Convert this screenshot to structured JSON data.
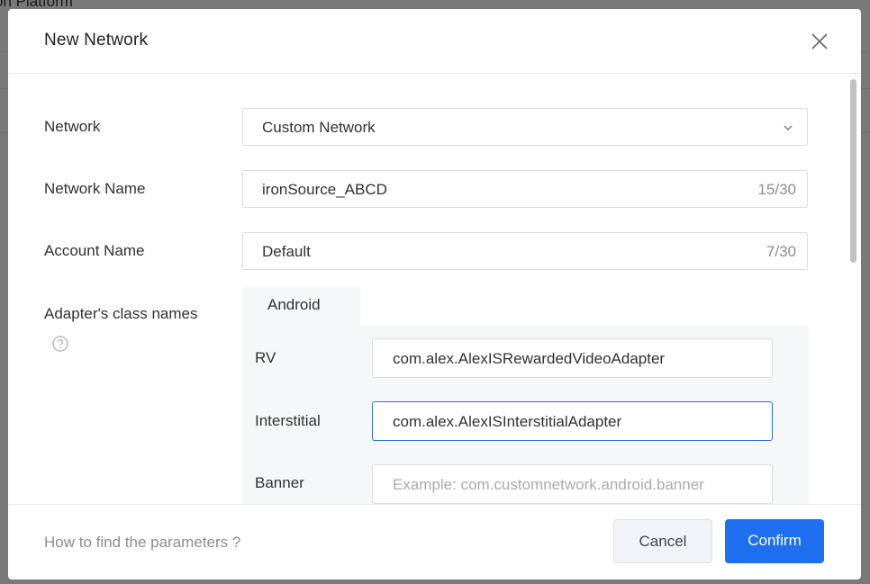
{
  "background": {
    "app_title": "on Platform"
  },
  "modal": {
    "title": "New Network",
    "form": {
      "network": {
        "label": "Network",
        "value": "Custom Network"
      },
      "network_name": {
        "label": "Network Name",
        "value": "ironSource_ABCD",
        "count": "15/30"
      },
      "account_name": {
        "label": "Account Name",
        "value": "Default",
        "count": "7/30"
      },
      "adapters": {
        "label": "Adapter's class names",
        "tabs": [
          {
            "label": "Android"
          }
        ],
        "rows": [
          {
            "label": "RV",
            "value": "com.alex.AlexISRewardedVideoAdapter",
            "placeholder": ""
          },
          {
            "label": "Interstitial",
            "value": "com.alex.AlexISInterstitialAdapter",
            "placeholder": ""
          },
          {
            "label": "Banner",
            "value": "",
            "placeholder": "Example: com.customnetwork.android.banner"
          }
        ]
      }
    },
    "footer": {
      "help_link": "How to find the parameters ?",
      "cancel_label": "Cancel",
      "confirm_label": "Confirm"
    },
    "colors": {
      "primary": "#1f6ff0",
      "focus_border": "#2b6fd6"
    }
  }
}
